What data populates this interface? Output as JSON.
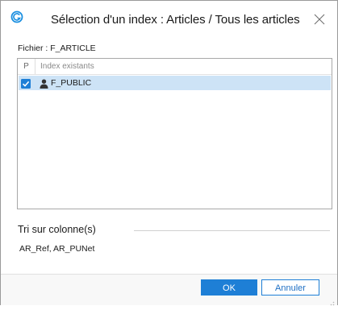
{
  "dialog": {
    "title": "Sélection d'un index : Articles / Tous les articles",
    "app_icon": "sage-logo-icon",
    "close_icon": "close-icon"
  },
  "file": {
    "label": "Fichier : F_ARTICLE"
  },
  "index_list": {
    "columns": [
      "P",
      "Index existants"
    ],
    "rows": [
      {
        "checked": true,
        "icon": "user-icon",
        "name": "F_PUBLIC",
        "selected": true
      }
    ]
  },
  "sort": {
    "title": "Tri sur colonne(s)",
    "value": "AR_Ref, AR_PUNet"
  },
  "buttons": {
    "ok_label": "OK",
    "cancel_label": "Annuler"
  },
  "colors": {
    "accent": "#1e7fd6",
    "row_selected": "#cde3f6"
  }
}
